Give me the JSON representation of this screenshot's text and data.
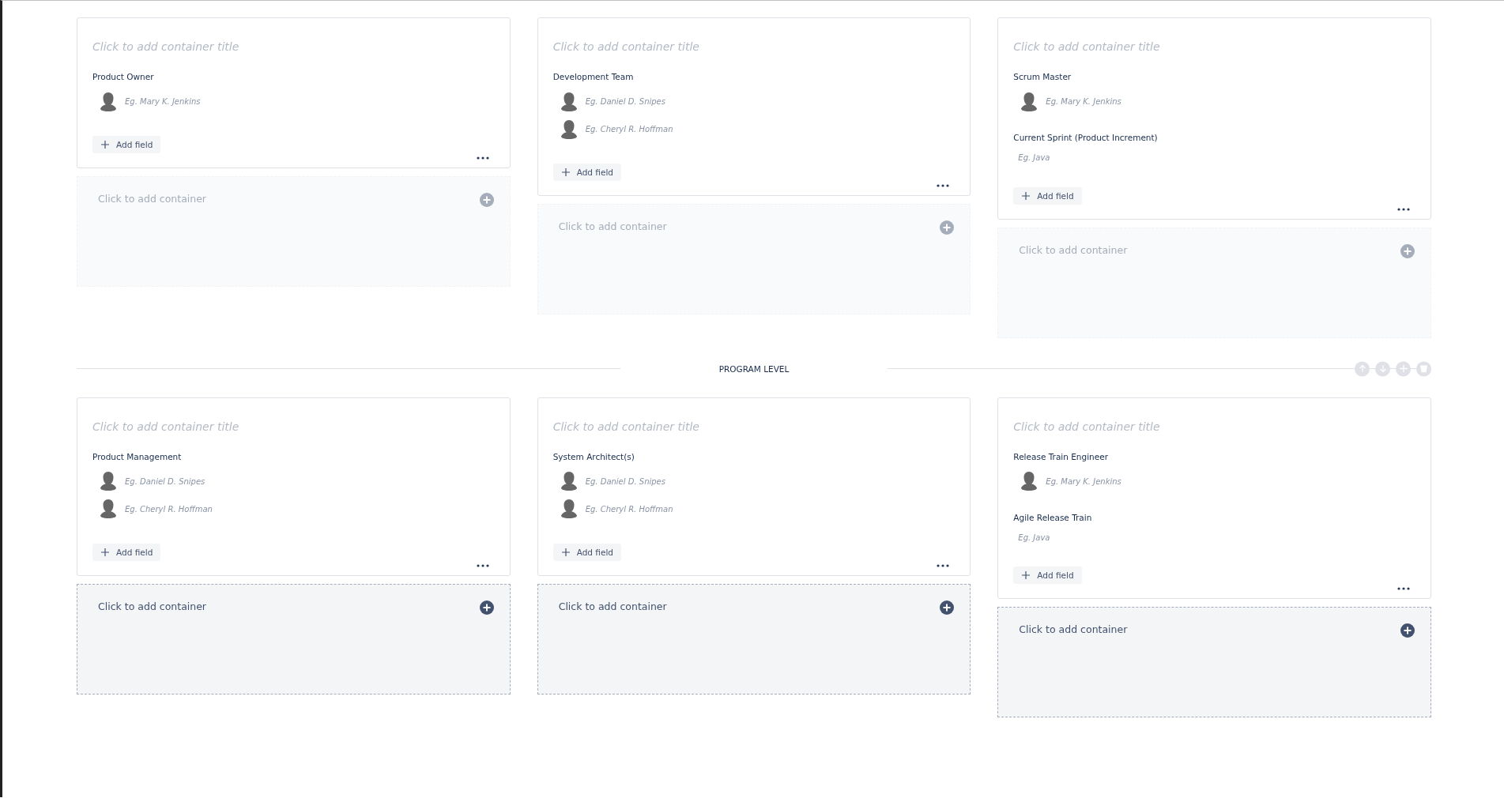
{
  "sections": [
    {
      "columns": [
        {
          "card": {
            "title": {
              "placeholder": "Click to add container title"
            },
            "fields": [
              {
                "kind": "people",
                "label": "Product Owner",
                "entries": [
                  {
                    "placeholder": "Eg. Mary K. Jenkins"
                  }
                ]
              }
            ],
            "add_field": "Add field"
          },
          "add_container": {
            "text": "Click to add container",
            "enabled": false
          }
        },
        {
          "card": {
            "title": {
              "placeholder": "Click to add container title"
            },
            "fields": [
              {
                "kind": "people",
                "label": "Development Team",
                "entries": [
                  {
                    "placeholder": "Eg. Daniel D. Snipes"
                  },
                  {
                    "placeholder": "Eg. Cheryl R. Hoffman"
                  }
                ]
              }
            ],
            "add_field": "Add field"
          },
          "add_container": {
            "text": "Click to add container",
            "enabled": false
          }
        },
        {
          "card": {
            "title": {
              "placeholder": "Click to add container title"
            },
            "fields": [
              {
                "kind": "people",
                "label": "Scrum Master",
                "entries": [
                  {
                    "placeholder": "Eg. Mary K. Jenkins"
                  }
                ]
              },
              {
                "kind": "text",
                "label": "Current Sprint (Product Increment)",
                "entries": [
                  {
                    "placeholder": "Eg. Java"
                  }
                ]
              }
            ],
            "add_field": "Add field"
          },
          "add_container": {
            "text": "Click to add container",
            "enabled": false
          }
        }
      ]
    },
    {
      "heading": "PROGRAM LEVEL",
      "controls": [
        {
          "kind": "up",
          "disabled": true
        },
        {
          "kind": "down",
          "disabled": true
        },
        {
          "kind": "add",
          "disabled": true
        },
        {
          "kind": "delete",
          "disabled": true
        }
      ],
      "columns": [
        {
          "card": {
            "title": {
              "placeholder": "Click to add container title"
            },
            "fields": [
              {
                "kind": "people",
                "label": "Product Management",
                "entries": [
                  {
                    "placeholder": "Eg. Daniel D. Snipes"
                  },
                  {
                    "placeholder": "Eg. Cheryl R. Hoffman"
                  }
                ]
              }
            ],
            "add_field": "Add field"
          },
          "add_container": {
            "text": "Click to add container",
            "enabled": true
          }
        },
        {
          "card": {
            "title": {
              "placeholder": "Click to add container title"
            },
            "fields": [
              {
                "kind": "people",
                "label": "System Architect(s)",
                "entries": [
                  {
                    "placeholder": "Eg. Daniel D. Snipes"
                  },
                  {
                    "placeholder": "Eg. Cheryl R. Hoffman"
                  }
                ]
              }
            ],
            "add_field": "Add field"
          },
          "add_container": {
            "text": "Click to add container",
            "enabled": true
          }
        },
        {
          "card": {
            "title": {
              "placeholder": "Click to add container title"
            },
            "fields": [
              {
                "kind": "people",
                "label": "Release Train Engineer",
                "entries": [
                  {
                    "placeholder": "Eg. Mary K. Jenkins"
                  }
                ]
              },
              {
                "kind": "text",
                "label": "Agile Release Train",
                "entries": [
                  {
                    "placeholder": "Eg. Java"
                  }
                ]
              }
            ],
            "add_field": "Add field"
          },
          "add_container": {
            "text": "Click to add container",
            "enabled": true
          }
        }
      ]
    }
  ]
}
